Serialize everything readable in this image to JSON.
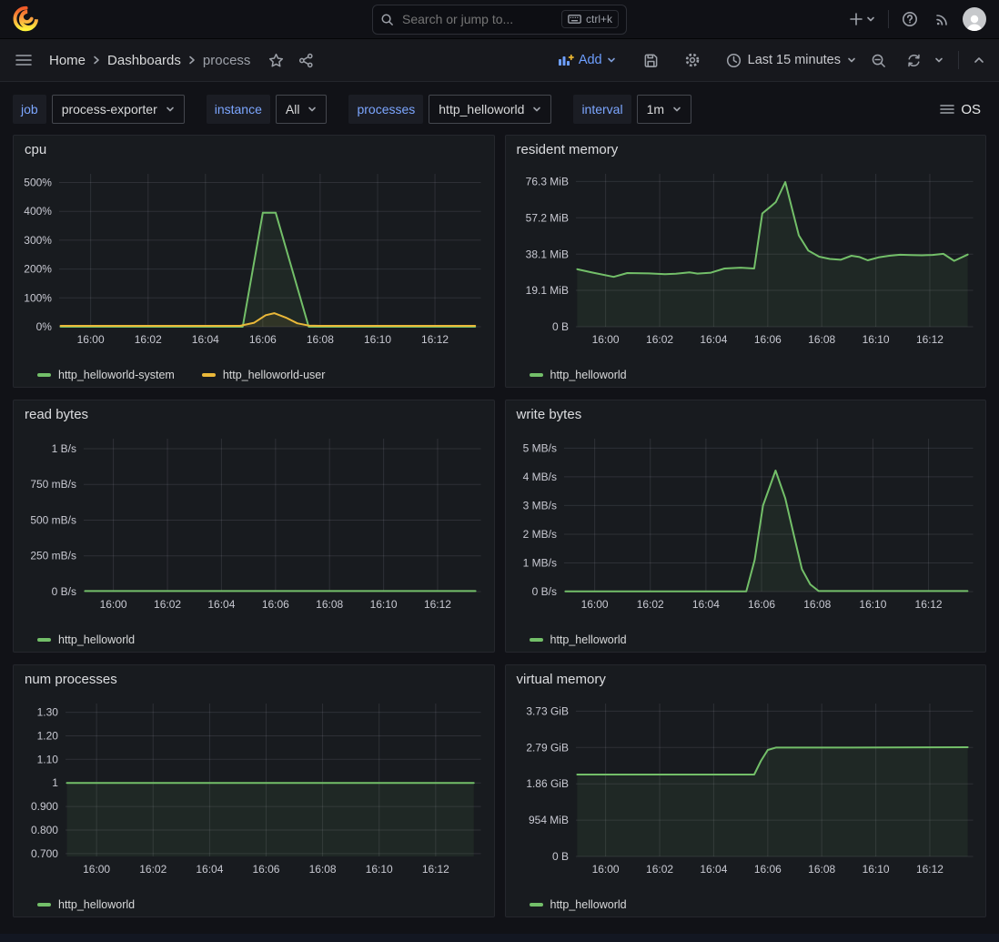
{
  "topbar": {
    "search_placeholder": "Search or jump to...",
    "shortcut": "ctrl+k"
  },
  "breadcrumbs": {
    "items": [
      "Home",
      "Dashboards",
      "process"
    ]
  },
  "toolbar": {
    "add_label": "Add",
    "time_range": "Last 15 minutes",
    "os_label": "OS"
  },
  "variables": [
    {
      "label": "job",
      "value": "process-exporter"
    },
    {
      "label": "instance",
      "value": "All"
    },
    {
      "label": "processes",
      "value": "http_helloworld"
    },
    {
      "label": "interval",
      "value": "1m"
    }
  ],
  "colors": {
    "accent_blue": "#6E9FFF",
    "series_green": "#73BF69",
    "series_yellow": "#EAB839",
    "panel_bg": "#181B1F",
    "page_bg": "#111217"
  },
  "icons": [
    "grafana-logo",
    "search",
    "keyboard",
    "plus",
    "chevron-down",
    "help",
    "rss",
    "avatar",
    "menu",
    "star",
    "share",
    "add-panel",
    "save",
    "settings",
    "clock",
    "zoom-out",
    "refresh",
    "collapse",
    "list"
  ],
  "chart_data": [
    {
      "type": "line",
      "title": "cpu",
      "x_note": "x values are minutes after 16:00",
      "x_domain": [
        -1.1,
        13.6
      ],
      "x_ticks": [
        {
          "v": 0,
          "label": "16:00"
        },
        {
          "v": 2,
          "label": "16:02"
        },
        {
          "v": 4,
          "label": "16:04"
        },
        {
          "v": 6,
          "label": "16:06"
        },
        {
          "v": 8,
          "label": "16:08"
        },
        {
          "v": 10,
          "label": "16:10"
        },
        {
          "v": 12,
          "label": "16:12"
        }
      ],
      "ylim": [
        0,
        530
      ],
      "ylabel": "cpu percent",
      "y_ticks": [
        {
          "v": 0,
          "label": "0%"
        },
        {
          "v": 100,
          "label": "100%"
        },
        {
          "v": 200,
          "label": "200%"
        },
        {
          "v": 300,
          "label": "300%"
        },
        {
          "v": 400,
          "label": "400%"
        },
        {
          "v": 500,
          "label": "500%"
        }
      ],
      "legend_position": "bottom",
      "series": [
        {
          "name": "http_helloworld-system",
          "color": "#73BF69",
          "points": [
            [
              -1.05,
              0
            ],
            [
              5.3,
              0
            ],
            [
              6.0,
              395
            ],
            [
              6.45,
              395
            ],
            [
              7.6,
              0
            ],
            [
              13.4,
              0
            ]
          ]
        },
        {
          "name": "http_helloworld-user",
          "color": "#EAB839",
          "points": [
            [
              -1.05,
              3
            ],
            [
              5.2,
              3
            ],
            [
              5.7,
              14
            ],
            [
              6.1,
              40
            ],
            [
              6.4,
              47
            ],
            [
              6.8,
              32
            ],
            [
              7.2,
              12
            ],
            [
              7.6,
              4
            ],
            [
              8.0,
              3
            ],
            [
              13.4,
              3
            ]
          ]
        }
      ]
    },
    {
      "type": "line",
      "title": "resident memory",
      "x_note": "x values are minutes after 16:00",
      "x_domain": [
        -1.1,
        13.6
      ],
      "x_ticks": [
        {
          "v": 0,
          "label": "16:00"
        },
        {
          "v": 2,
          "label": "16:02"
        },
        {
          "v": 4,
          "label": "16:04"
        },
        {
          "v": 6,
          "label": "16:06"
        },
        {
          "v": 8,
          "label": "16:08"
        },
        {
          "v": 10,
          "label": "16:10"
        },
        {
          "v": 12,
          "label": "16:12"
        }
      ],
      "ylim": [
        0,
        80.3
      ],
      "ylabel": "MiB",
      "y_ticks": [
        {
          "v": 0,
          "label": "0 B"
        },
        {
          "v": 19.1,
          "label": "19.1 MiB"
        },
        {
          "v": 38.1,
          "label": "38.1 MiB"
        },
        {
          "v": 57.2,
          "label": "57.2 MiB"
        },
        {
          "v": 76.3,
          "label": "76.3 MiB"
        }
      ],
      "legend_position": "bottom",
      "series": [
        {
          "name": "http_helloworld",
          "color": "#73BF69",
          "points": [
            [
              -1.05,
              30.2
            ],
            [
              -0.5,
              28.5
            ],
            [
              0.3,
              26.2
            ],
            [
              0.8,
              28.2
            ],
            [
              1.6,
              28.0
            ],
            [
              2.2,
              27.6
            ],
            [
              2.6,
              27.8
            ],
            [
              3.1,
              28.6
            ],
            [
              3.4,
              27.9
            ],
            [
              3.9,
              28.4
            ],
            [
              4.4,
              30.6
            ],
            [
              5.0,
              31.0
            ],
            [
              5.5,
              30.6
            ],
            [
              5.8,
              59.5
            ],
            [
              6.1,
              63.0
            ],
            [
              6.3,
              65.5
            ],
            [
              6.65,
              76.0
            ],
            [
              6.9,
              62.0
            ],
            [
              7.15,
              48.0
            ],
            [
              7.5,
              40.0
            ],
            [
              7.9,
              36.8
            ],
            [
              8.3,
              35.6
            ],
            [
              8.7,
              35.2
            ],
            [
              9.1,
              37.3
            ],
            [
              9.4,
              36.6
            ],
            [
              9.7,
              34.9
            ],
            [
              10.1,
              36.4
            ],
            [
              10.5,
              37.3
            ],
            [
              10.9,
              37.8
            ],
            [
              11.3,
              37.6
            ],
            [
              11.7,
              37.5
            ],
            [
              12.1,
              37.7
            ],
            [
              12.5,
              38.3
            ],
            [
              12.9,
              34.6
            ],
            [
              13.4,
              37.9
            ]
          ]
        }
      ]
    },
    {
      "type": "line",
      "title": "read bytes",
      "x_note": "x values are minutes after 16:00",
      "x_domain": [
        -1.1,
        13.6
      ],
      "x_ticks": [
        {
          "v": 0,
          "label": "16:00"
        },
        {
          "v": 2,
          "label": "16:02"
        },
        {
          "v": 4,
          "label": "16:04"
        },
        {
          "v": 6,
          "label": "16:06"
        },
        {
          "v": 8,
          "label": "16:08"
        },
        {
          "v": 10,
          "label": "16:10"
        },
        {
          "v": 12,
          "label": "16:12"
        }
      ],
      "ylim": [
        0,
        1.07
      ],
      "ylabel": "B/s",
      "y_ticks": [
        {
          "v": 0,
          "label": "0 B/s"
        },
        {
          "v": 0.25,
          "label": "250 mB/s"
        },
        {
          "v": 0.5,
          "label": "500 mB/s"
        },
        {
          "v": 0.75,
          "label": "750 mB/s"
        },
        {
          "v": 1,
          "label": "1 B/s"
        }
      ],
      "legend_position": "bottom",
      "series": [
        {
          "name": "http_helloworld",
          "color": "#73BF69",
          "points": [
            [
              -1.05,
              0.004
            ],
            [
              13.4,
              0.004
            ]
          ]
        }
      ]
    },
    {
      "type": "line",
      "title": "write bytes",
      "x_note": "x values are minutes after 16:00",
      "x_domain": [
        -1.1,
        13.6
      ],
      "x_ticks": [
        {
          "v": 0,
          "label": "16:00"
        },
        {
          "v": 2,
          "label": "16:02"
        },
        {
          "v": 4,
          "label": "16:04"
        },
        {
          "v": 6,
          "label": "16:06"
        },
        {
          "v": 8,
          "label": "16:08"
        },
        {
          "v": 10,
          "label": "16:10"
        },
        {
          "v": 12,
          "label": "16:12"
        }
      ],
      "ylim": [
        0,
        5.33
      ],
      "ylabel": "MB/s",
      "y_ticks": [
        {
          "v": 0,
          "label": "0 B/s"
        },
        {
          "v": 1,
          "label": "1 MB/s"
        },
        {
          "v": 2,
          "label": "2 MB/s"
        },
        {
          "v": 3,
          "label": "3 MB/s"
        },
        {
          "v": 4,
          "label": "4 MB/s"
        },
        {
          "v": 5,
          "label": "5 MB/s"
        }
      ],
      "legend_position": "bottom",
      "series": [
        {
          "name": "http_helloworld",
          "color": "#73BF69",
          "points": [
            [
              -1.05,
              0.01
            ],
            [
              5.45,
              0.01
            ],
            [
              5.75,
              1.1
            ],
            [
              6.05,
              3.0
            ],
            [
              6.5,
              4.22
            ],
            [
              6.85,
              3.25
            ],
            [
              7.15,
              2.0
            ],
            [
              7.45,
              0.78
            ],
            [
              7.75,
              0.25
            ],
            [
              8.05,
              0.02
            ],
            [
              13.4,
              0.02
            ]
          ]
        }
      ]
    },
    {
      "type": "line",
      "title": "num processes",
      "x_note": "x values are minutes after 16:00",
      "x_domain": [
        -1.1,
        13.6
      ],
      "x_ticks": [
        {
          "v": 0,
          "label": "16:00"
        },
        {
          "v": 2,
          "label": "16:02"
        },
        {
          "v": 4,
          "label": "16:04"
        },
        {
          "v": 6,
          "label": "16:06"
        },
        {
          "v": 8,
          "label": "16:08"
        },
        {
          "v": 10,
          "label": "16:10"
        },
        {
          "v": 12,
          "label": "16:12"
        }
      ],
      "ylim": [
        0.688,
        1.337
      ],
      "ylabel": "processes",
      "y_ticks": [
        {
          "v": 0.7,
          "label": "0.700"
        },
        {
          "v": 0.8,
          "label": "0.800"
        },
        {
          "v": 0.9,
          "label": "0.900"
        },
        {
          "v": 1,
          "label": "1"
        },
        {
          "v": 1.1,
          "label": "1.10"
        },
        {
          "v": 1.2,
          "label": "1.20"
        },
        {
          "v": 1.3,
          "label": "1.30"
        }
      ],
      "legend_position": "bottom",
      "series": [
        {
          "name": "http_helloworld",
          "color": "#73BF69",
          "points": [
            [
              -1.05,
              1
            ],
            [
              13.35,
              1
            ]
          ]
        }
      ]
    },
    {
      "type": "line",
      "title": "virtual memory",
      "x_note": "x values are minutes after 16:00; y values in GiB",
      "x_domain": [
        -1.1,
        13.6
      ],
      "x_ticks": [
        {
          "v": 0,
          "label": "16:00"
        },
        {
          "v": 2,
          "label": "16:02"
        },
        {
          "v": 4,
          "label": "16:04"
        },
        {
          "v": 6,
          "label": "16:06"
        },
        {
          "v": 8,
          "label": "16:08"
        },
        {
          "v": 10,
          "label": "16:10"
        },
        {
          "v": 12,
          "label": "16:12"
        }
      ],
      "ylim": [
        0,
        3.92
      ],
      "ylabel": "GiB",
      "y_ticks": [
        {
          "v": 0,
          "label": "0 B"
        },
        {
          "v": 0.932,
          "label": "954 MiB"
        },
        {
          "v": 1.863,
          "label": "1.86 GiB"
        },
        {
          "v": 2.794,
          "label": "2.79 GiB"
        },
        {
          "v": 3.725,
          "label": "3.73 GiB"
        }
      ],
      "legend_position": "bottom",
      "series": [
        {
          "name": "http_helloworld",
          "color": "#73BF69",
          "points": [
            [
              -1.05,
              2.1
            ],
            [
              5.5,
              2.1
            ],
            [
              5.75,
              2.45
            ],
            [
              6.0,
              2.73
            ],
            [
              6.3,
              2.79
            ],
            [
              9.0,
              2.79
            ],
            [
              13.4,
              2.8
            ]
          ]
        }
      ]
    }
  ]
}
